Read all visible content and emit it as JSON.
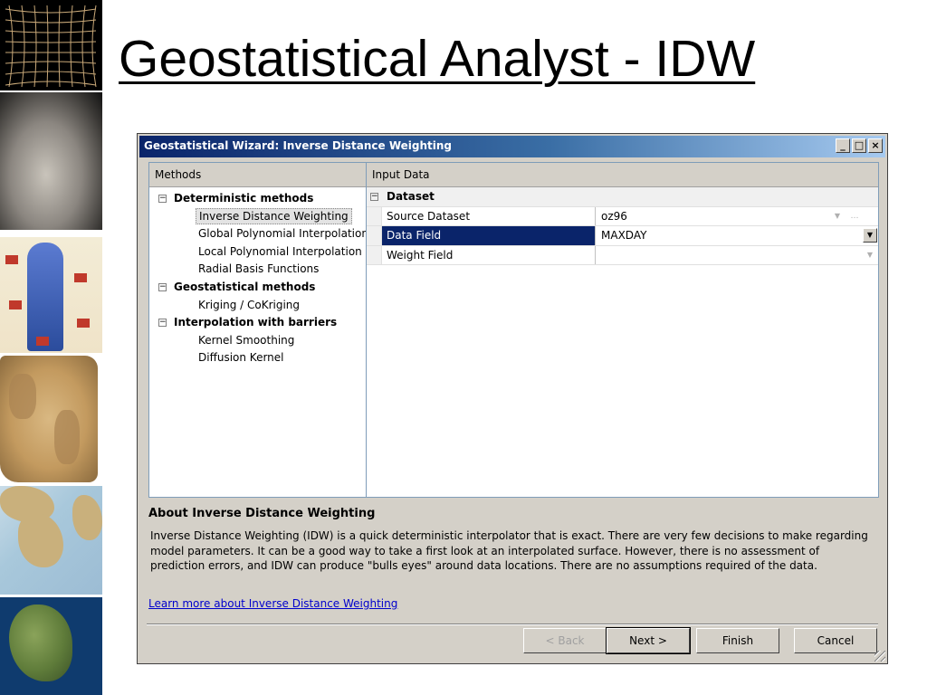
{
  "slide": {
    "title": "Geostatistical Analyst - IDW"
  },
  "dialog": {
    "title": "Geostatistical Wizard: Inverse Distance Weighting",
    "window_buttons": {
      "minimize": "_",
      "maximize": "□",
      "close": "×"
    },
    "methods": {
      "header": "Methods",
      "groups": [
        {
          "label": "Deterministic methods",
          "items": [
            "Inverse Distance Weighting",
            "Global Polynomial Interpolation",
            "Local Polynomial Interpolation",
            "Radial Basis Functions"
          ]
        },
        {
          "label": "Geostatistical methods",
          "items": [
            "Kriging / CoKriging"
          ]
        },
        {
          "label": "Interpolation with barriers",
          "items": [
            "Kernel Smoothing",
            "Diffusion Kernel"
          ]
        }
      ],
      "selected": "Inverse Distance Weighting"
    },
    "input_data": {
      "header": "Input Data",
      "category": "Dataset",
      "rows": [
        {
          "name": "Source Dataset",
          "value": "oz96"
        },
        {
          "name": "Data Field",
          "value": "MAXDAY"
        },
        {
          "name": "Weight Field",
          "value": ""
        }
      ]
    },
    "about": {
      "title": "About Inverse Distance Weighting",
      "text": "Inverse Distance Weighting (IDW) is a quick deterministic interpolator that is exact. There are very few decisions to make regarding model parameters. It can be a good way to take a first look at an interpolated surface. However, there is no assessment of prediction errors, and IDW can produce \"bulls eyes\" around data locations. There are no assumptions required of the data.",
      "link": "Learn more about Inverse Distance Weighting"
    },
    "buttons": {
      "back": "< Back",
      "next": "Next >",
      "finish": "Finish",
      "cancel": "Cancel"
    }
  }
}
